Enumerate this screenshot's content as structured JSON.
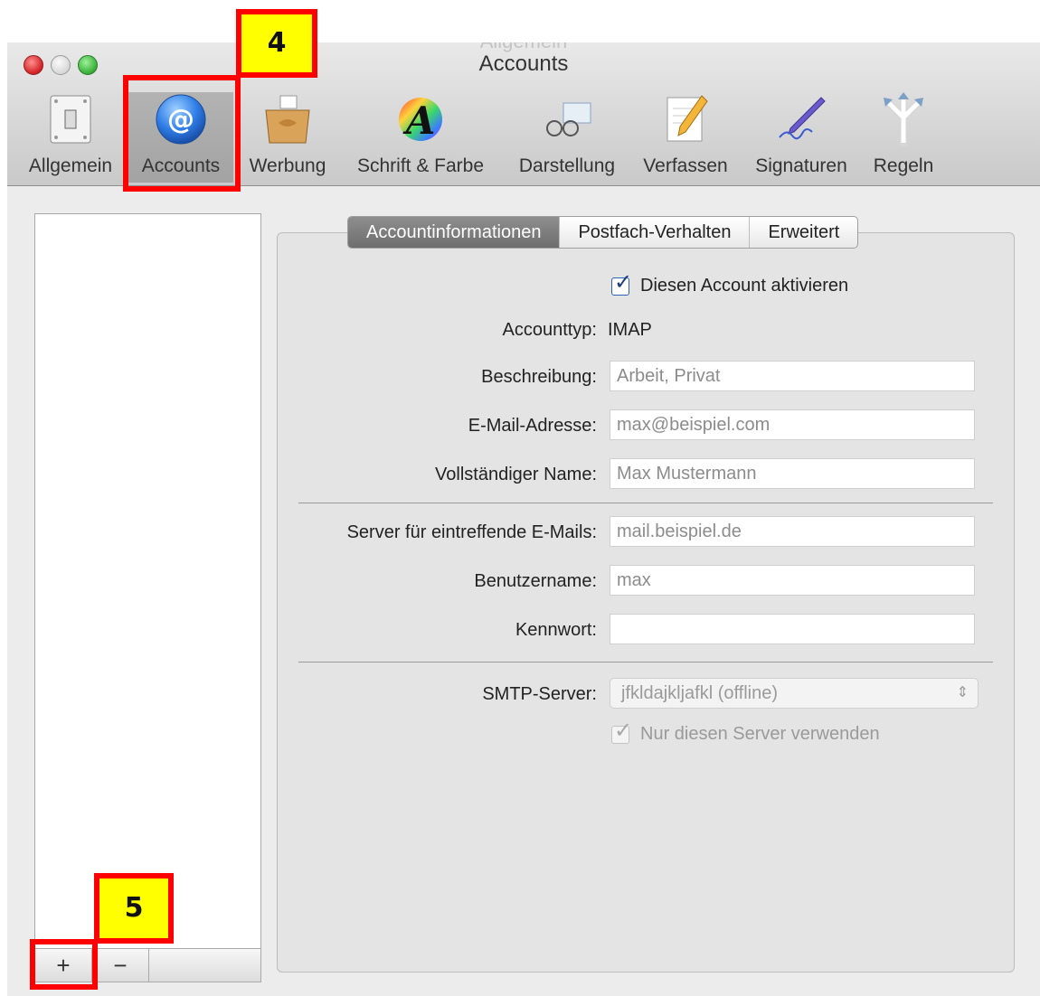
{
  "window": {
    "title_shadow": "Allgemein",
    "title": "Accounts"
  },
  "toolbar": {
    "items": [
      {
        "label": "Allgemein",
        "icon": "switch-icon"
      },
      {
        "label": "Accounts",
        "icon": "at-sign-icon",
        "selected": true
      },
      {
        "label": "Werbung",
        "icon": "junk-mail-icon"
      },
      {
        "label": "Schrift & Farbe",
        "icon": "font-color-icon"
      },
      {
        "label": "Darstellung",
        "icon": "viewing-glasses-icon"
      },
      {
        "label": "Verfassen",
        "icon": "compose-pencil-icon"
      },
      {
        "label": "Signaturen",
        "icon": "signature-pen-icon"
      },
      {
        "label": "Regeln",
        "icon": "rules-arrows-icon"
      }
    ]
  },
  "account_list": {
    "add_label": "+",
    "remove_label": "−"
  },
  "tabs": [
    {
      "label": "Accountinformationen",
      "active": true
    },
    {
      "label": "Postfach-Verhalten",
      "active": false
    },
    {
      "label": "Erweitert",
      "active": false
    }
  ],
  "form": {
    "enable_account_label": "Diesen Account aktivieren",
    "enable_account_checked": true,
    "account_type_label": "Accounttyp:",
    "account_type_value": "IMAP",
    "description_label": "Beschreibung:",
    "description_placeholder": "Arbeit, Privat",
    "email_label": "E-Mail-Adresse:",
    "email_placeholder": "max@beispiel.com",
    "fullname_label": "Vollständiger Name:",
    "fullname_placeholder": "Max Mustermann",
    "incoming_server_label": "Server für eintreffende E-Mails:",
    "incoming_server_placeholder": "mail.beispiel.de",
    "username_label": "Benutzername:",
    "username_placeholder": "max",
    "password_label": "Kennwort:",
    "password_value": "",
    "smtp_label": "SMTP-Server:",
    "smtp_value": "jfkldajkljafkl (offline)",
    "only_server_label": "Nur diesen Server verwenden",
    "only_server_checked": true
  },
  "annotations": {
    "step4": "4",
    "step5": "5",
    "highlight_color": "#ff0000",
    "label_bg": "#ffff00"
  }
}
